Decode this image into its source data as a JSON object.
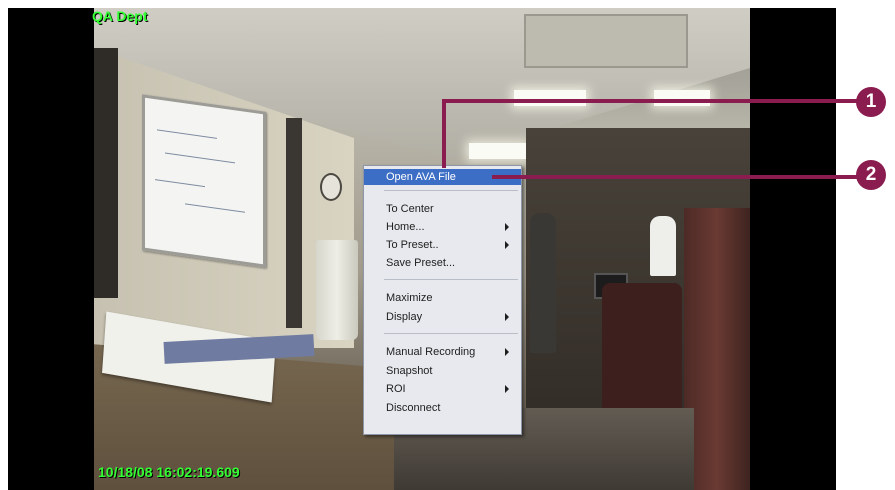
{
  "camera": {
    "name": "QA Dept",
    "timestamp": "10/18/08 16:02:19.609"
  },
  "context_menu": {
    "items": [
      {
        "label": "Open AVA File",
        "selected": true,
        "submenu": false
      },
      {
        "label": "To Center",
        "submenu": false
      },
      {
        "label": "Home...",
        "submenu": true
      },
      {
        "label": "To Preset..",
        "submenu": true
      },
      {
        "label": "Save Preset...",
        "submenu": false
      },
      {
        "label": "Maximize",
        "submenu": false
      },
      {
        "label": "Display",
        "submenu": true
      },
      {
        "label": "Manual Recording",
        "submenu": true
      },
      {
        "label": "Snapshot",
        "submenu": false
      },
      {
        "label": "ROI",
        "submenu": true
      },
      {
        "label": "Disconnect",
        "submenu": false
      }
    ]
  },
  "callouts": [
    {
      "label": "1"
    },
    {
      "label": "2"
    }
  ],
  "colors": {
    "overlay_text": "#33ff33",
    "callout": "#8a1c4f",
    "menu_highlight": "#3d6ec5"
  }
}
